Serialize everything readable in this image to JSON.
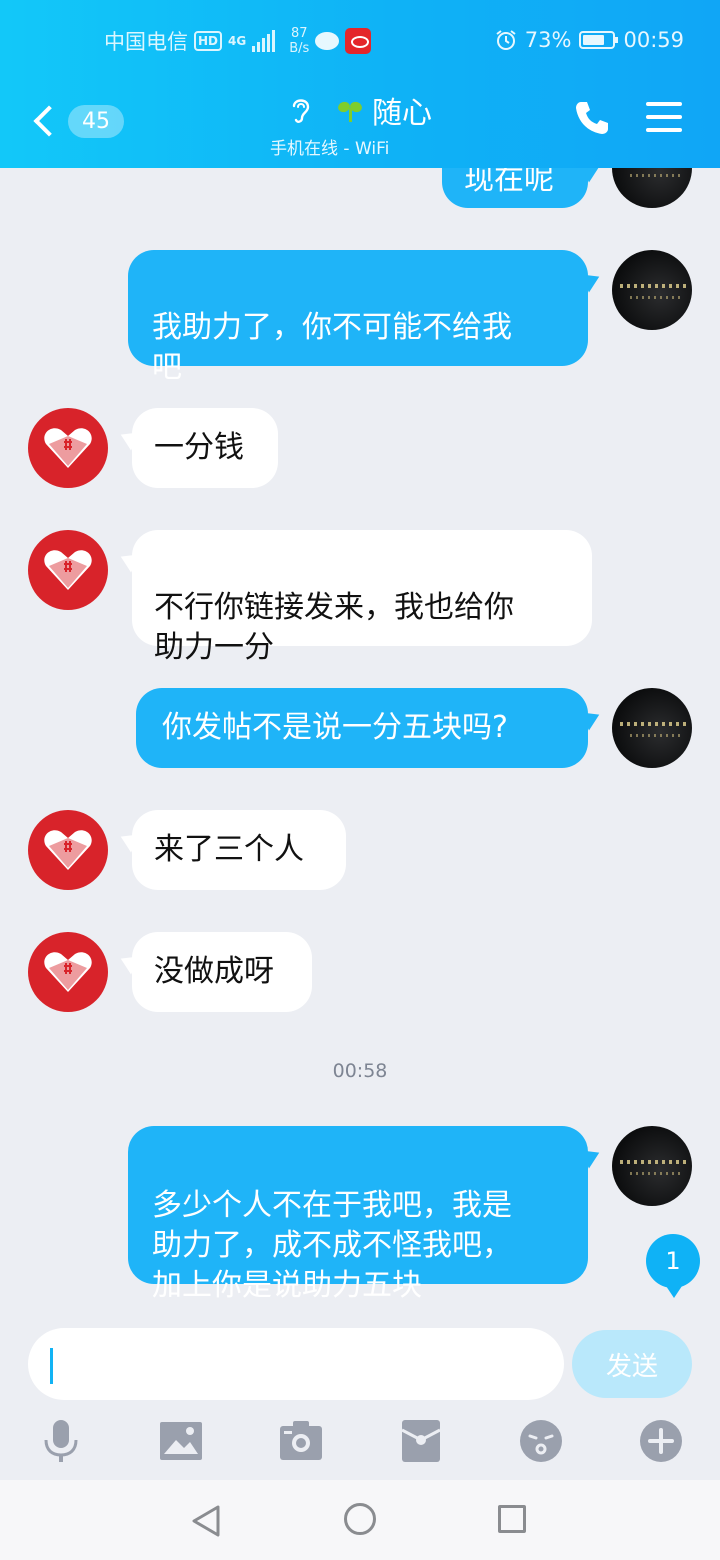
{
  "status_bar": {
    "carrier": "中国电信",
    "hd": "HD",
    "network": "4G",
    "speed_value": "87",
    "speed_unit": "B/s",
    "battery": "73%",
    "battery_level": 0.73,
    "time": "00:59"
  },
  "header": {
    "unread_count": "45",
    "contact_name": "随心",
    "contact_status": "手机在线 - WiFi"
  },
  "messages": [
    {
      "id": "m0",
      "side": "out",
      "text": "现在呢"
    },
    {
      "id": "m1",
      "side": "out",
      "text": "我助力了，你不可能不给我\n吧"
    },
    {
      "id": "m2",
      "side": "in",
      "text": "一分钱"
    },
    {
      "id": "m3",
      "side": "in",
      "text": "不行你链接发来，我也给你\n助力一分"
    },
    {
      "id": "m4",
      "side": "out",
      "text": "你发帖不是说一分五块吗?"
    },
    {
      "id": "m5",
      "side": "in",
      "text": "来了三个人"
    },
    {
      "id": "m6",
      "side": "in",
      "text": "没做成呀"
    },
    {
      "id": "m7",
      "side": "out",
      "text": "多少个人不在于我吧，我是\n助力了，成不成不怪我吧，\n加上你是说助力五块"
    }
  ],
  "timestamp": "00:58",
  "new_message_badge": "1",
  "input": {
    "value": "",
    "send_label": "发送"
  },
  "toolbar": [
    "mic-icon",
    "image-icon",
    "camera-icon",
    "red-packet-icon",
    "emoji-icon",
    "plus-icon"
  ],
  "colors": {
    "header": "#0fb2f6",
    "bubble_out": "#1fb4f8",
    "bubble_in": "#ffffff",
    "background": "#eceef3"
  }
}
